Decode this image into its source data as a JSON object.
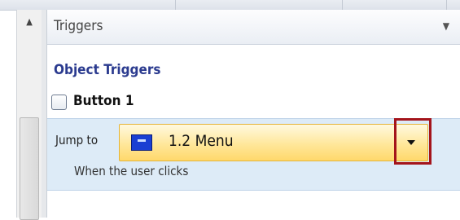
{
  "panel": {
    "title": "Triggers",
    "menu_icon": "chevron-down-icon"
  },
  "object_triggers": {
    "heading": "Object Triggers",
    "object_label": "Button 1",
    "object_checked": false
  },
  "trigger": {
    "action_label": "Jump to",
    "target_value": "1.2 Menu",
    "target_icon": "slide-icon",
    "condition": "When the user clicks"
  },
  "colors": {
    "heading": "#2b3b8f",
    "row_highlight": "#ddebf7",
    "combo_fill": "#ffe79a",
    "callout_border": "#a4141b"
  }
}
